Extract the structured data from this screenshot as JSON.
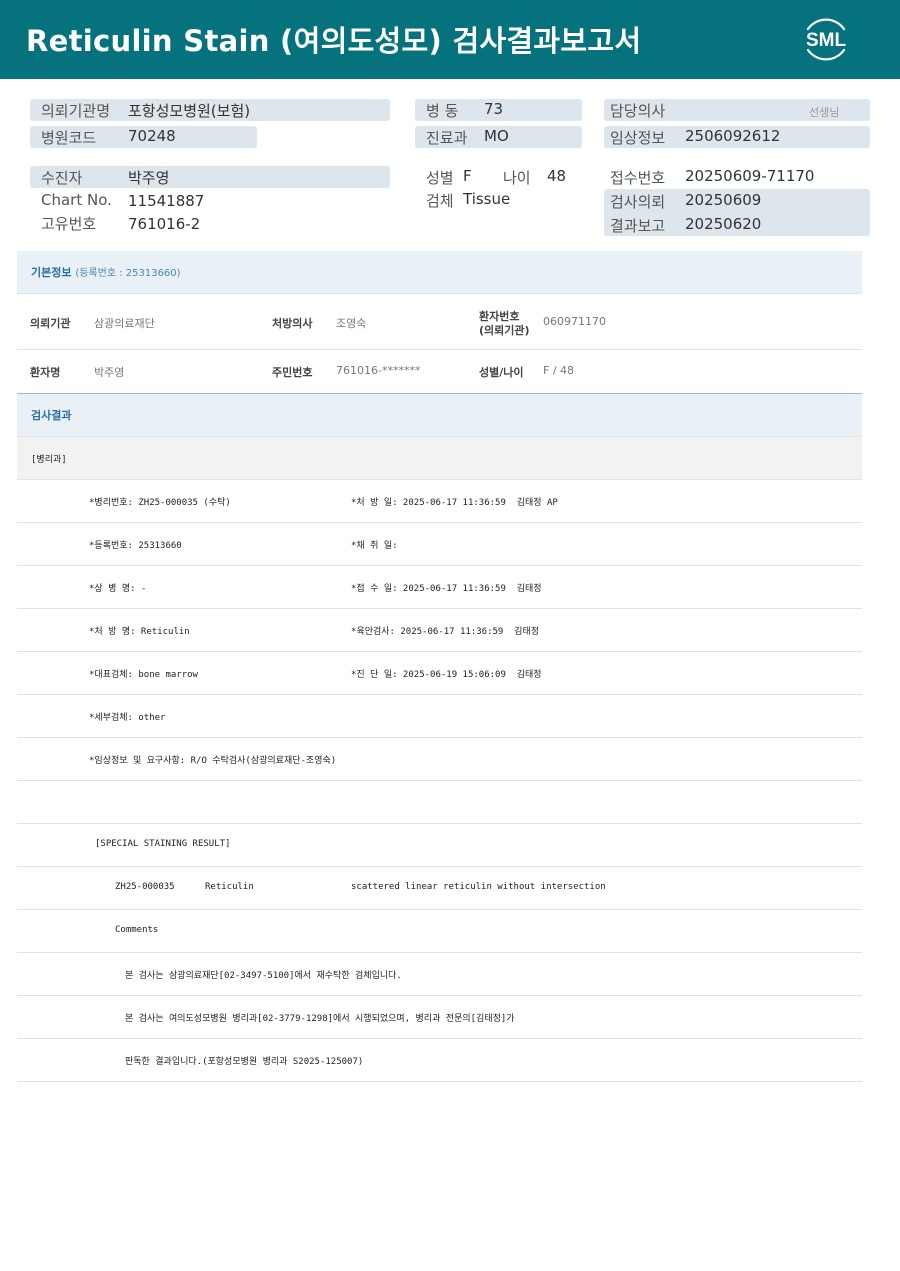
{
  "header": {
    "title": "Reticulin Stain (여의도성모) 검사결과보고서",
    "logo_text": "SML"
  },
  "patient_info": {
    "institution_label": "의뢰기관명",
    "institution_value": "포항성모병원(보험)",
    "hospital_code_label": "병원코드",
    "hospital_code_value": "70248",
    "ward_label": "병   동",
    "ward_value": "73",
    "department_label": "진료과",
    "department_value": "MO",
    "doctor_label": "담당의사",
    "doctor_suffix": "선생님",
    "clinical_info_label": "임상정보",
    "clinical_info_value": "2506092612",
    "patient_label": "수진자",
    "patient_value": "박주영",
    "chart_label": "Chart No.",
    "chart_value": "11541887",
    "unique_label": "고유번호",
    "unique_value": "761016-2",
    "sex_label": "성별",
    "sex_value": "F",
    "age_label": "나이",
    "age_value": "48",
    "specimen_label": "검체",
    "specimen_value": "Tissue",
    "receipt_label": "접수번호",
    "receipt_value": "20250609-71170",
    "request_label": "검사의뢰",
    "request_value": "20250609",
    "report_label": "결과보고",
    "report_value": "20250620"
  },
  "basic_info": {
    "title": "기본정보",
    "subtitle": "(등록번호 : 25313660)",
    "institution_key": "의뢰기관",
    "institution_val": "삼광의료재단",
    "prescriber_key": "처방의사",
    "prescriber_val": "조영숙",
    "patient_no_key_1": "환자번호",
    "patient_no_key_2": "(의뢰기관)",
    "patient_no_val": "060971170",
    "patient_name_key": "환자명",
    "patient_name_val": "박주영",
    "rrn_key": "주민번호",
    "rrn_val": "761016-*******",
    "sex_age_key": "성별/나이",
    "sex_age_val": "F / 48"
  },
  "results": {
    "title": "검사결과",
    "dept": "[병리과]",
    "path_no": "*병리번호: ZH25-000035 (수탁)",
    "order_date": "*처 방 일: 2025-06-17 11:36:59  김태정 AP",
    "reg_no": "*등록번호: 25313660",
    "collect_date": "*채 취 일:",
    "disease": "*상 병 명: -",
    "receive_date": "*접 수 일: 2025-06-17 11:36:59  김태정",
    "order_name": "*처 방 명: Reticulin",
    "gross_exam": "*육안검사: 2025-06-17 11:36:59  김태정",
    "main_specimen": "*대표검체: bone marrow",
    "diagnosis_date": "*진 단 일: 2025-06-19 15:06:09  김태정",
    "sub_specimen": "*세부검체: other",
    "clinical_request": "*임상정보 및 요구사항: R/O 수탁검사(삼광의료재단-조영숙)",
    "special_header": "[SPECIAL STAINING RESULT]",
    "stain_id": "ZH25-000035",
    "stain_name": "Reticulin",
    "stain_result": "scattered linear reticulin without intersection",
    "comments_label": "Comments",
    "comment_1": "본 검사는 삼광의료재단[02-3497-5100]에서 재수탁한 검체입니다.",
    "comment_2": "본 검사는 여의도성모병원 병리과[02-3779-1298]에서 시행되었으며, 병리과 전문의[김태정]가",
    "comment_3": "판독한 결과입니다.(포항성모병원 병리과 S2025-125007)"
  },
  "colors": {
    "header_bg": "#06727e",
    "info_box": "#dce6ec",
    "section_bg": "#eaf1f6",
    "section_title": "#2d6da3"
  }
}
